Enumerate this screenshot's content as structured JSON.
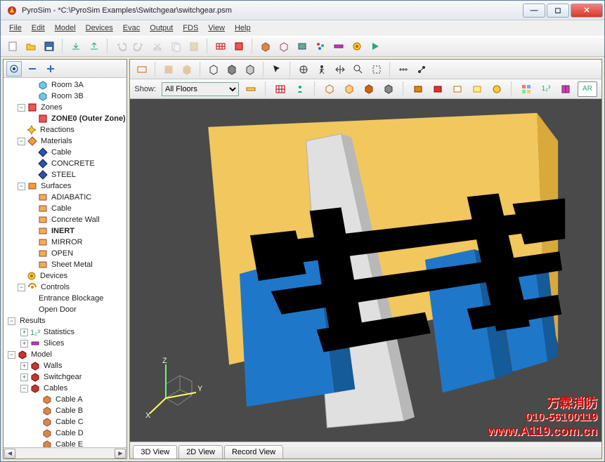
{
  "title": "PyroSim - *C:\\PyroSim Examples\\Switchgear\\switchgear.psm",
  "menus": [
    "File",
    "Edit",
    "Model",
    "Devices",
    "Evac",
    "Output",
    "FDS",
    "View",
    "Help"
  ],
  "show_label": "Show:",
  "floors_selected": "All Floors",
  "tabs": {
    "v3d": "3D View",
    "v2d": "2D View",
    "rec": "Record View"
  },
  "toolbar2_btn_ar": "AR",
  "axis": {
    "x": "X",
    "y": "Y",
    "z": "Z"
  },
  "watermark": {
    "l1": "万霖消防",
    "l2": "010-56100119",
    "l3": "www.A119.com.cn"
  },
  "tree": {
    "room3a": "Room 3A",
    "room3b": "Room 3B",
    "zones": "Zones",
    "zone0": "ZONE0 (Outer Zone)",
    "reactions": "Reactions",
    "materials": "Materials",
    "cable": "Cable",
    "concrete": "CONCRETE",
    "steel": "STEEL",
    "surfaces": "Surfaces",
    "adiabatic": "ADIABATIC",
    "s_cable": "Cable",
    "cwall": "Concrete Wall",
    "inert": "INERT",
    "mirror": "MIRROR",
    "open": "OPEN",
    "sheet": "Sheet Metal",
    "devices": "Devices",
    "controls": "Controls",
    "entblock": "Entrance Blockage",
    "opendoor": "Open Door",
    "results": "Results",
    "stats": "Statistics",
    "slices": "Slices",
    "model": "Model",
    "walls": "Walls",
    "switchgear": "Switchgear",
    "cables": "Cables",
    "cablea": "Cable A",
    "cableb": "Cable B",
    "cablec": "Cable C",
    "cabled": "Cable D",
    "cablee": "Cable E"
  }
}
